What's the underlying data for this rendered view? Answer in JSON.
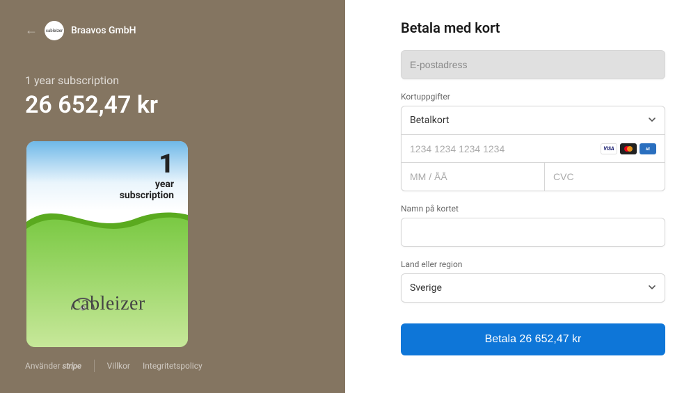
{
  "merchant": {
    "name": "Braavos GmbH",
    "logo_text": "cableizer"
  },
  "product": {
    "label": "1 year subscription",
    "price": "26 652,47 kr",
    "card_number": "1",
    "card_line1": "year",
    "card_line2": "subscription",
    "card_brand": "cableizer"
  },
  "footer": {
    "powered_by": "Använder",
    "stripe": "stripe",
    "terms": "Villkor",
    "privacy": "Integritetspolicy"
  },
  "form": {
    "title": "Betala med kort",
    "email_placeholder": "E-postadress",
    "card_info_label": "Kortuppgifter",
    "payment_method": "Betalkort",
    "card_number_placeholder": "1234 1234 1234 1234",
    "expiry_placeholder": "MM / ÅÅ",
    "cvc_placeholder": "CVC",
    "name_label": "Namn på kortet",
    "country_label": "Land eller region",
    "country_value": "Sverige",
    "pay_button": "Betala 26 652,47 kr"
  },
  "colors": {
    "left_bg": "#847561",
    "primary_button": "#0e76d8"
  }
}
